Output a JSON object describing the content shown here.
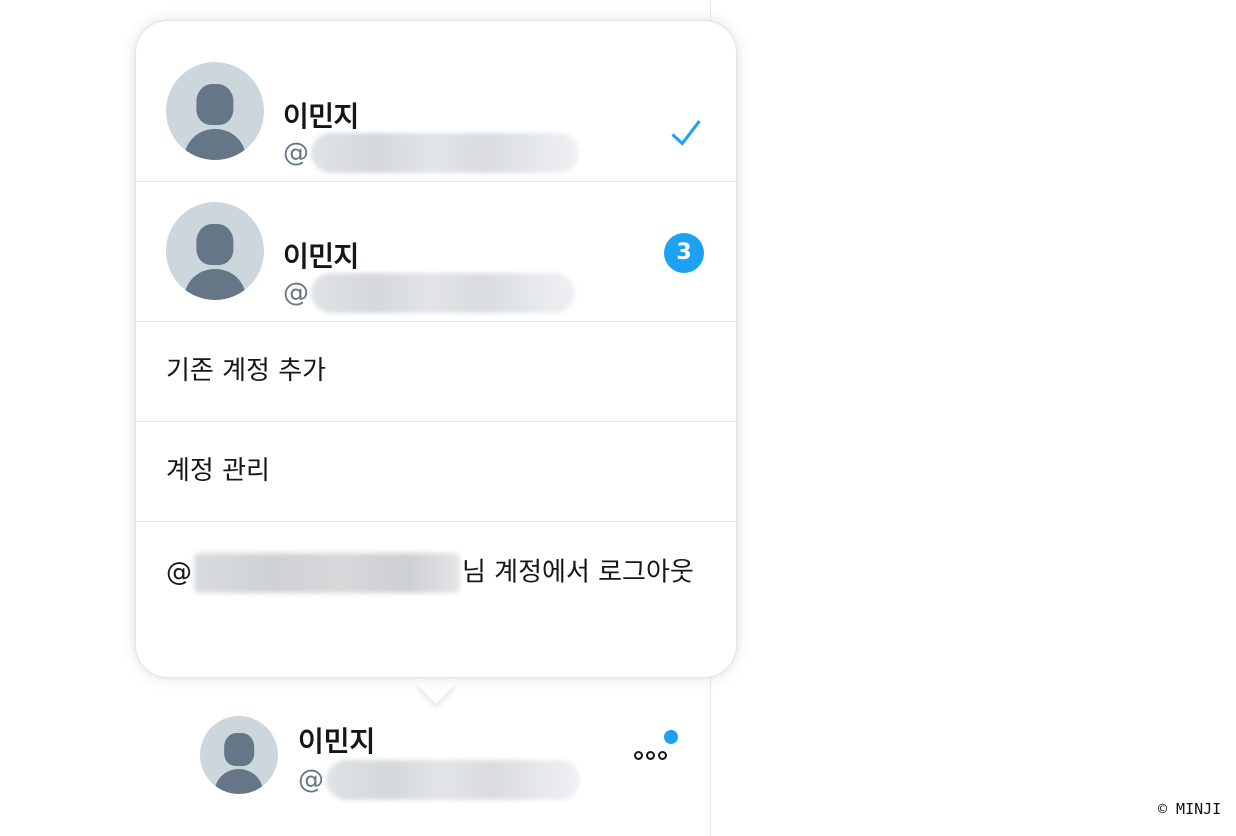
{
  "popup": {
    "accounts": [
      {
        "name": "이민지",
        "handle_prefix": "@",
        "status": "active-check"
      },
      {
        "name": "이민지",
        "handle_prefix": "@",
        "badge": "3"
      }
    ],
    "menu": {
      "add_existing": "기존 계정 추가",
      "manage": "계정 관리",
      "logout_prefix": "@",
      "logout_suffix": "님 계정에서 로그아웃"
    }
  },
  "switcher": {
    "name": "이민지",
    "handle_prefix": "@",
    "more_icon": "more-horizontal-icon"
  },
  "colors": {
    "accent": "#1da1f2",
    "avatar_bg": "#ccd6dd",
    "avatar_fg": "#657786"
  },
  "watermark": "© MINJI"
}
